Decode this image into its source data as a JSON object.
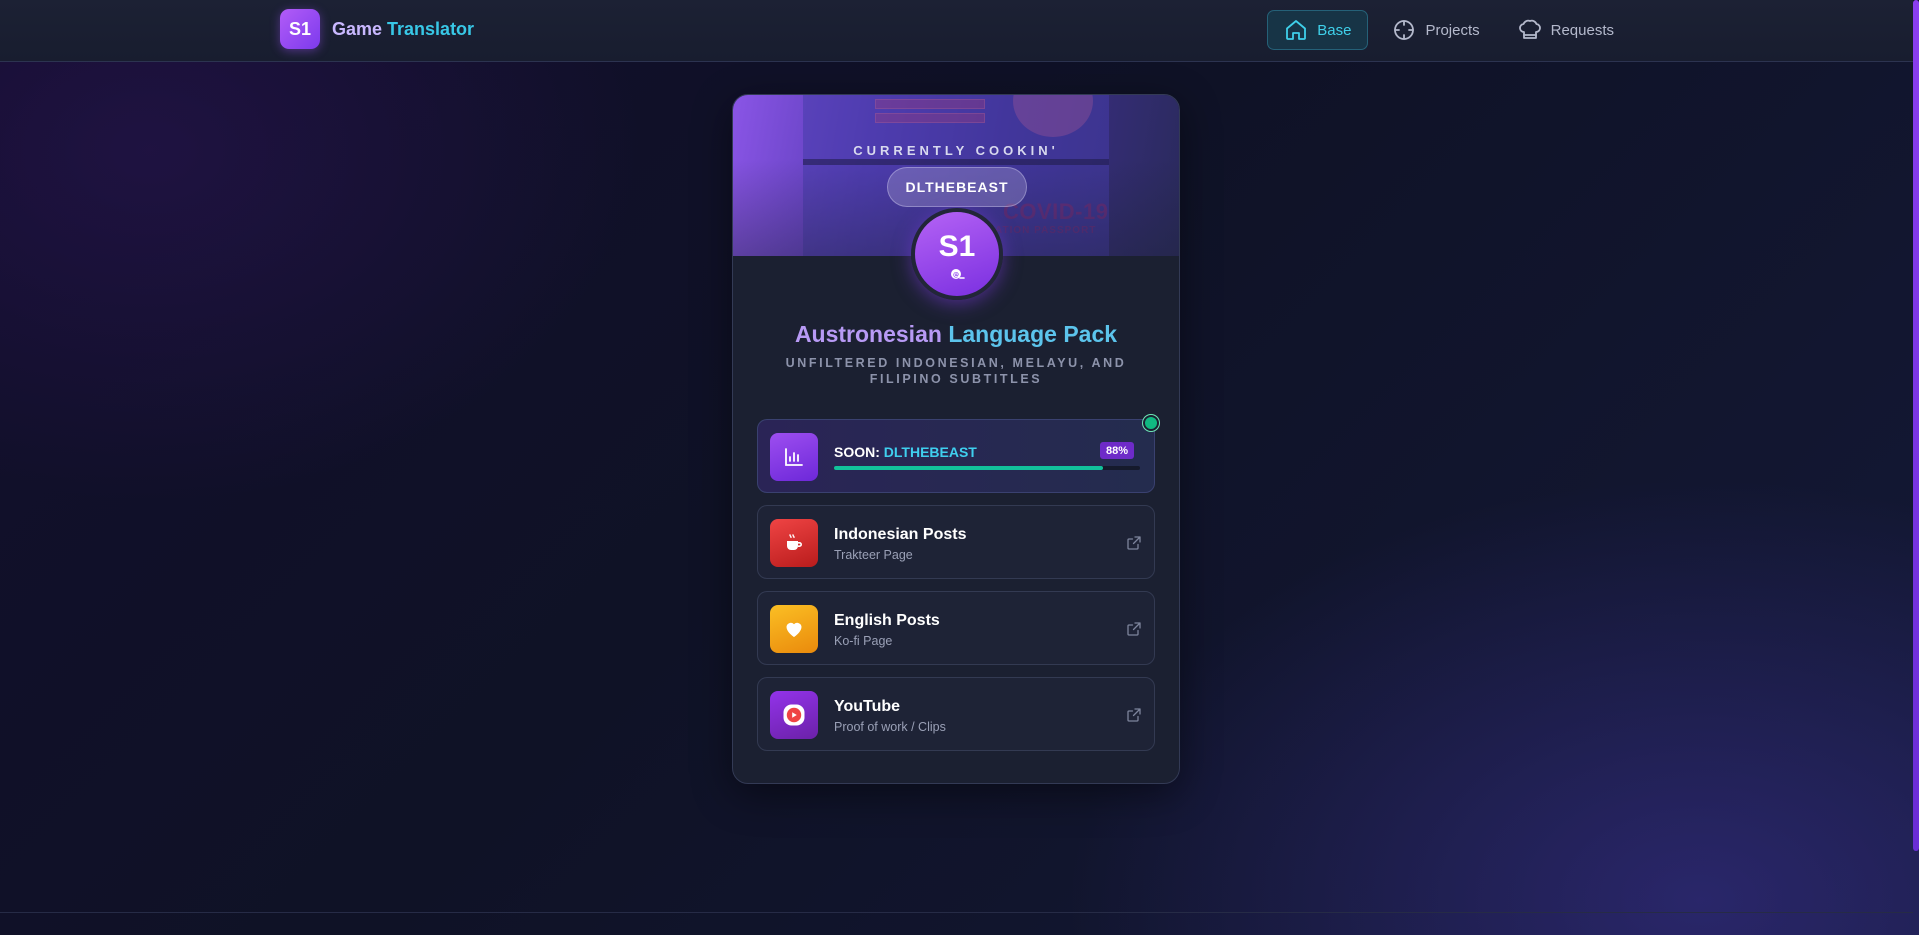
{
  "header": {
    "logo_text": "S1",
    "brand_word1": "Game",
    "brand_word2": "Translator",
    "nav": [
      {
        "label": "Base",
        "icon": "home-icon",
        "active": true
      },
      {
        "label": "Projects",
        "icon": "crosshair-icon",
        "active": false
      },
      {
        "label": "Requests",
        "icon": "chef-hat-icon",
        "active": false
      }
    ]
  },
  "card": {
    "banner_tag": "CURRENTLY COOKIN'",
    "author": "DLTHEBEAST",
    "avatar_text": "S1",
    "title_part1": "Austronesian",
    "title_part2": "Language Pack",
    "subtitle": "UNFILTERED INDONESIAN, MELAYU, AND FILIPINO SUBTITLES",
    "progress": {
      "label": "SOON:",
      "name": "DLTHEBEAST",
      "percent_text": "88%",
      "percent": 0.88,
      "icon": "bar-chart-icon"
    },
    "links": [
      {
        "title": "Indonesian Posts",
        "subtitle": "Trakteer Page",
        "icon": "coffee-icon",
        "color": "#dc2626"
      },
      {
        "title": "English Posts",
        "subtitle": "Ko-fi Page",
        "icon": "heart-icon",
        "color": "#f59e0b"
      },
      {
        "title": "YouTube",
        "subtitle": "Proof of work / Clips",
        "icon": "youtube-icon",
        "color": "#7e22ce"
      }
    ]
  },
  "colors": {
    "accent_purple": "#8b5cf6",
    "accent_cyan": "#38c7e6",
    "progress_green": "#12c19b",
    "status_online": "#10b981"
  }
}
